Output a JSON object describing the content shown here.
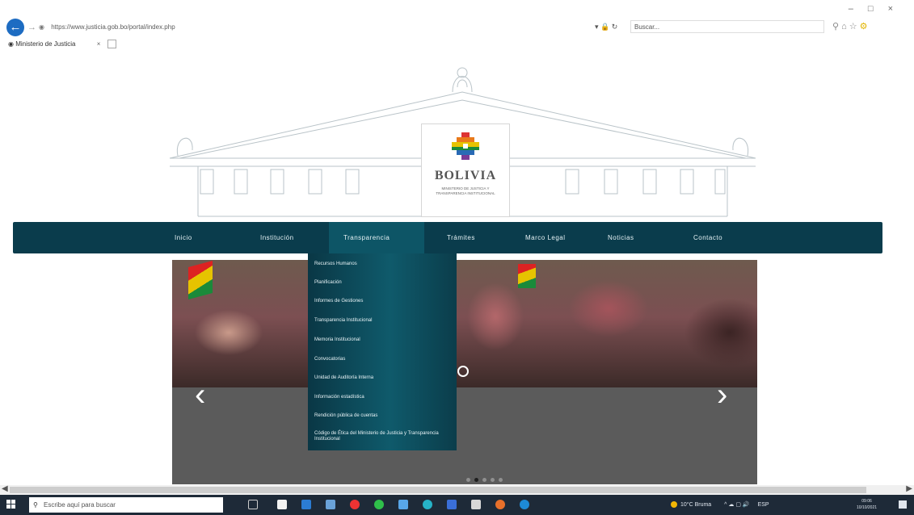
{
  "browser": {
    "url": "https://www.justicia.gob.bo/portal/index.php",
    "search_placeholder": "Buscar...",
    "tab_title": "Ministerio de Justicia"
  },
  "header": {
    "logo_title": "BOLIVIA",
    "logo_subtitle": "MINISTERIO DE JUSTICIA Y TRANSPARENCIA INSTITUCIONAL"
  },
  "nav": {
    "items": [
      "Inicio",
      "Institución",
      "Transparencia",
      "Trámites",
      "Marco Legal",
      "Noticias",
      "Contacto"
    ],
    "active": "Transparencia"
  },
  "dropdown": {
    "items": [
      "Recursos Humanos",
      "Planificación",
      "Informes de Gestiones",
      "Transparencia Institucional",
      "Memoria Institucional",
      "Convocatorias",
      "Unidad de Auditoría Interna",
      "Información estadística",
      "Rendición pública de cuentas",
      "Código de Ética del Ministerio de Justicia y Transparencia Institucional"
    ]
  },
  "slider": {
    "slide_count": 5,
    "active_index": 1
  },
  "taskbar": {
    "search_placeholder": "Escribe aquí para buscar",
    "weather": "10°C Bruma",
    "lang": "ESP",
    "time": "09:06",
    "date": "10/10/2021"
  },
  "colors": {
    "nav_bg": "#0a3c4c",
    "nav_active": "#0d5566",
    "taskbar_bg": "#1e2a38"
  }
}
